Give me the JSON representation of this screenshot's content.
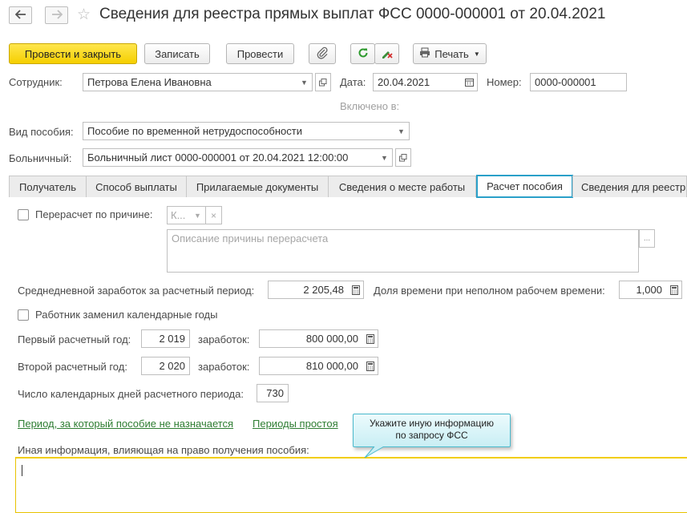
{
  "window": {
    "title": "Сведения для реестра прямых выплат ФСС 0000-000001 от 20.04.2021"
  },
  "toolbar": {
    "post_close_label": "Провести и закрыть",
    "save_label": "Записать",
    "post_label": "Провести",
    "print_label": "Печать"
  },
  "header": {
    "employee_label": "Сотрудник:",
    "employee_value": "Петрова Елена Ивановна",
    "date_label": "Дата:",
    "date_value": "20.04.2021",
    "number_label": "Номер:",
    "number_value": "0000-000001",
    "included_label": "Включено в:",
    "benefit_type_label": "Вид пособия:",
    "benefit_type_value": "Пособие по временной нетрудоспособности",
    "sick_leave_label": "Больничный:",
    "sick_leave_value": "Больничный лист 0000-000001 от 20.04.2021 12:00:00"
  },
  "tabs": [
    {
      "label": "Получатель",
      "active": false
    },
    {
      "label": "Способ выплаты",
      "active": false
    },
    {
      "label": "Прилагаемые документы",
      "active": false
    },
    {
      "label": "Сведения о месте работы",
      "active": false
    },
    {
      "label": "Расчет пособия",
      "active": true
    },
    {
      "label": "Сведения для реестр",
      "active": false
    }
  ],
  "calc": {
    "recalc_label": "Перерасчет по причине:",
    "recalc_checked": false,
    "reason_code": "К...",
    "reason_description_placeholder": "Описание причины перерасчета",
    "avg_earnings_label": "Среднедневной заработок за расчетный период:",
    "avg_earnings_value": "2 205,48",
    "parttime_share_label": "Доля времени при неполном рабочем времени:",
    "parttime_share_value": "1,000",
    "replaced_years_label": "Работник заменил календарные годы",
    "replaced_years_checked": false,
    "first_year_label": "Первый расчетный год:",
    "first_year_value": "2 019",
    "first_earnings_label": "заработок:",
    "first_earnings_value": "800 000,00",
    "second_year_label": "Второй расчетный год:",
    "second_year_value": "2 020",
    "second_earnings_label": "заработок:",
    "second_earnings_value": "810 000,00",
    "calendar_days_label": "Число календарных дней расчетного периода:",
    "calendar_days_value": "730",
    "link_not_assigned": "Период, за который пособие не назначается",
    "link_downtime": "Периоды простоя",
    "other_info_label": "Иная информация, влияющая на право получения пособия:",
    "other_info_value": ""
  },
  "tooltip": {
    "line1": "Укажите иную информацию",
    "line2": "по запросу ФСС"
  },
  "colors": {
    "primary_button": "#f5cf00",
    "active_tab_border": "#2aa0c9",
    "link": "#2e7d32",
    "tooltip_bg": "#d4f1f6",
    "focus_border": "#f2cd00"
  }
}
